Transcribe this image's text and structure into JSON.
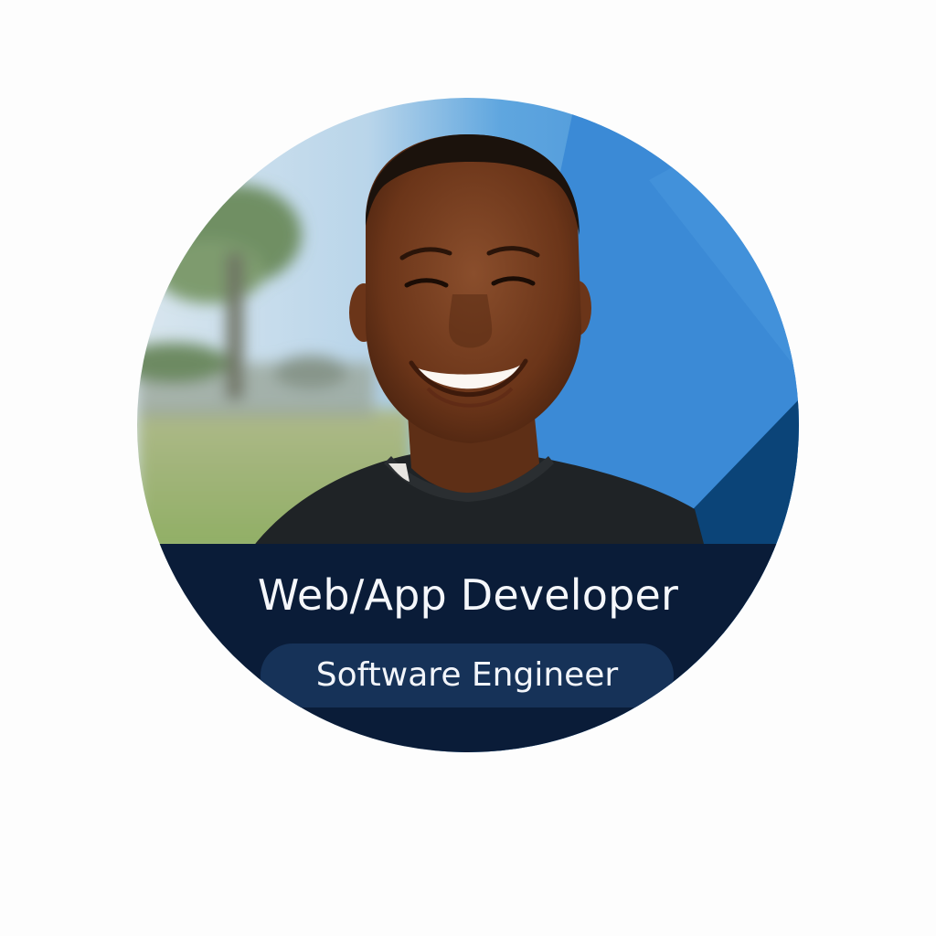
{
  "profile": {
    "headline": "Web/App Developer",
    "subtitle": "Software Engineer"
  },
  "colors": {
    "page_background": "#fdfdfd",
    "band": "#0a1c38",
    "pill": "#163258",
    "accent_blue": "#3b8ad6",
    "dark_blue": "#0b4478",
    "text": "#f5f7fb"
  }
}
